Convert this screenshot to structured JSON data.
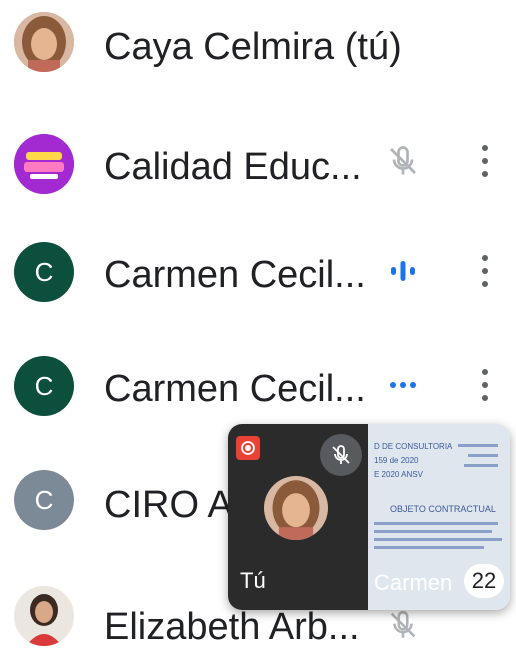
{
  "participants": [
    {
      "name": "Caya Celmira (tú)",
      "avatar": "photo",
      "status": "none"
    },
    {
      "name": "Calidad Educ...",
      "avatar": "purple-logo",
      "status": "muted",
      "status_icon": "mic-off-icon"
    },
    {
      "name": "Carmen Cecil...",
      "avatar": "letter",
      "letter": "C",
      "avatar_color": "#0b4f3c",
      "status": "speaking",
      "status_icon": "audio-bars-icon"
    },
    {
      "name": "Carmen Cecil...",
      "avatar": "letter",
      "letter": "C",
      "avatar_color": "#0b4f3c",
      "status": "connecting",
      "status_icon": "dots-icon"
    },
    {
      "name": "CIRO A",
      "avatar": "letter",
      "letter": "C",
      "avatar_color": "#7b8a96",
      "status": "hidden"
    },
    {
      "name": "Elizabeth Arb...",
      "avatar": "photo2",
      "status": "muted",
      "status_icon": "mic-off-icon"
    }
  ],
  "pip": {
    "self_label": "Tú",
    "remote_label": "Carmen",
    "count": "22",
    "doc": {
      "line1": "D DE CONSULTORIA",
      "line2": "159 de 2020",
      "line3": "E 2020 ANSV",
      "heading": "OBJETO CONTRACTUAL"
    }
  },
  "colors": {
    "accent_blue": "#1a73e8",
    "muted_icon": "#9aa0a6",
    "record_red": "#ea4335"
  }
}
